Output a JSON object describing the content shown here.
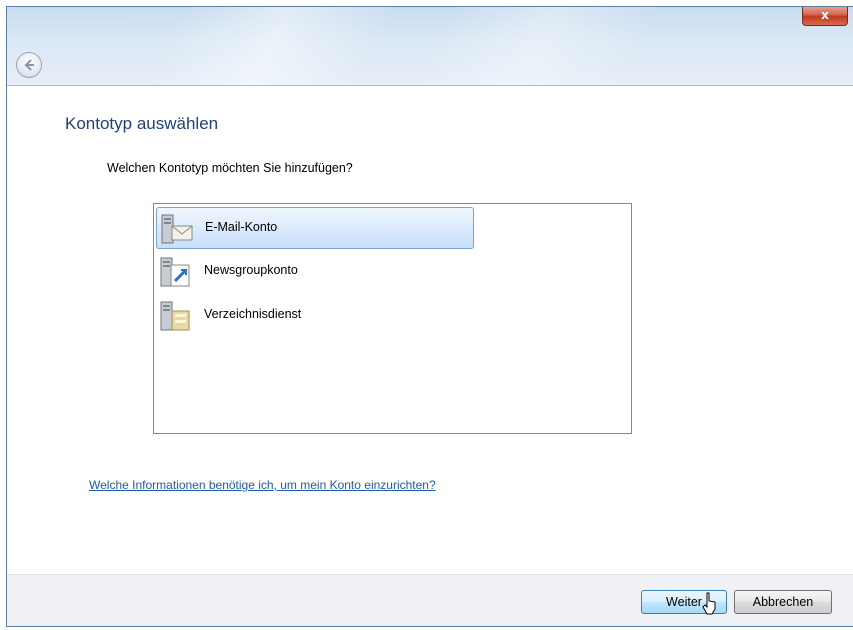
{
  "window": {
    "close_label": "x"
  },
  "header": {
    "title": "Kontotyp auswählen",
    "question": "Welchen Kontotyp möchten Sie hinzufügen?"
  },
  "account_types": {
    "items": [
      {
        "label": "E-Mail-Konto",
        "icon": "email-account-icon",
        "selected": true
      },
      {
        "label": "Newsgroupkonto",
        "icon": "newsgroup-account-icon",
        "selected": false
      },
      {
        "label": "Verzeichnisdienst",
        "icon": "directory-service-icon",
        "selected": false
      }
    ]
  },
  "help": {
    "link_text": "Welche Informationen benötige ich, um mein Konto einzurichten?"
  },
  "footer": {
    "next_label": "Weiter",
    "cancel_label": "Abbrechen"
  },
  "colors": {
    "heading": "#1e3f84",
    "link": "#1e5bb4",
    "selection": "#c7defa"
  }
}
